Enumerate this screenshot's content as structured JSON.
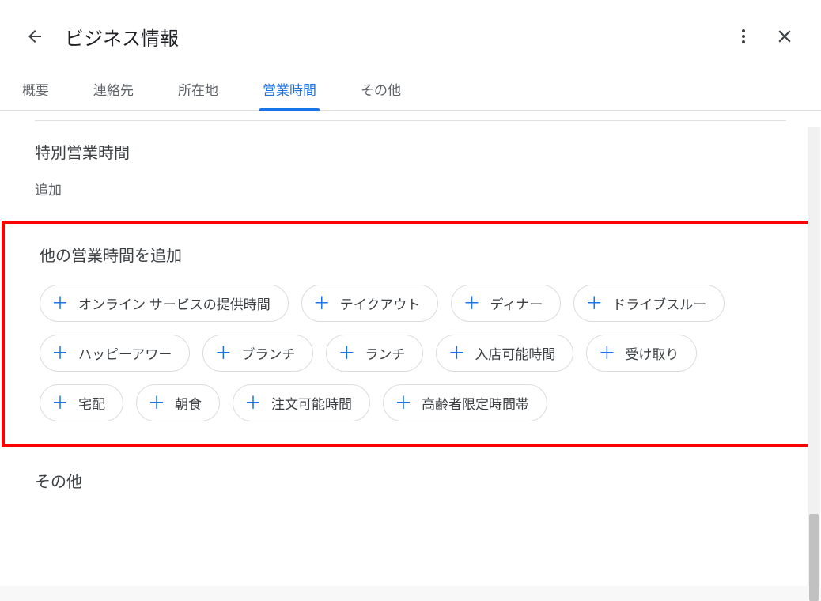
{
  "header": {
    "title": "ビジネス情報"
  },
  "tabs": [
    {
      "label": "概要",
      "active": false
    },
    {
      "label": "連絡先",
      "active": false
    },
    {
      "label": "所在地",
      "active": false
    },
    {
      "label": "営業時間",
      "active": true
    },
    {
      "label": "その他",
      "active": false
    }
  ],
  "special_hours": {
    "title": "特別営業時間",
    "add_label": "追加"
  },
  "more_hours": {
    "title": "他の営業時間を追加",
    "chips": [
      "オンライン サービスの提供時間",
      "テイクアウト",
      "ディナー",
      "ドライブスルー",
      "ハッピーアワー",
      "ブランチ",
      "ランチ",
      "入店可能時間",
      "受け取り",
      "宅配",
      "朝食",
      "注文可能時間",
      "高齢者限定時間帯"
    ]
  },
  "bottom_peek": "その他"
}
